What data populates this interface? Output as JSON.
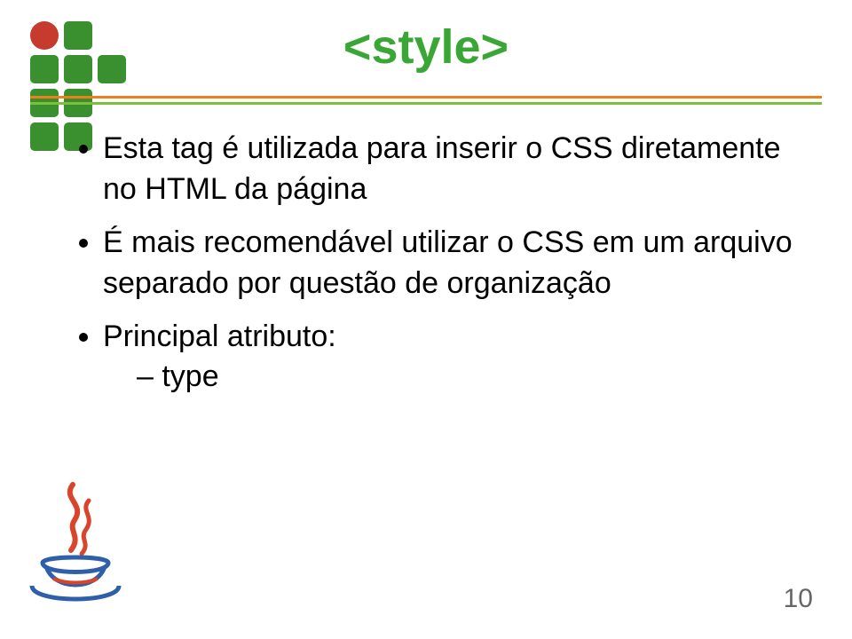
{
  "slide": {
    "title": "<style>",
    "bullets": [
      "Esta tag é utilizada para inserir o CSS diretamente no HTML da página",
      "É mais recomendável utilizar o CSS em um arquivo separado por questão de organização",
      "Principal atributo:"
    ],
    "sub_bullet": "type",
    "page_number": "10"
  },
  "icons": {
    "logo": "if-institute-logo",
    "corner": "java-steaming-cup"
  },
  "colors": {
    "title_green": "#3aa636",
    "divider_orange": "#ef7f1a",
    "divider_green": "#7bbf3a",
    "logo_green": "#3a8f2e",
    "logo_red": "#c73a2e"
  }
}
